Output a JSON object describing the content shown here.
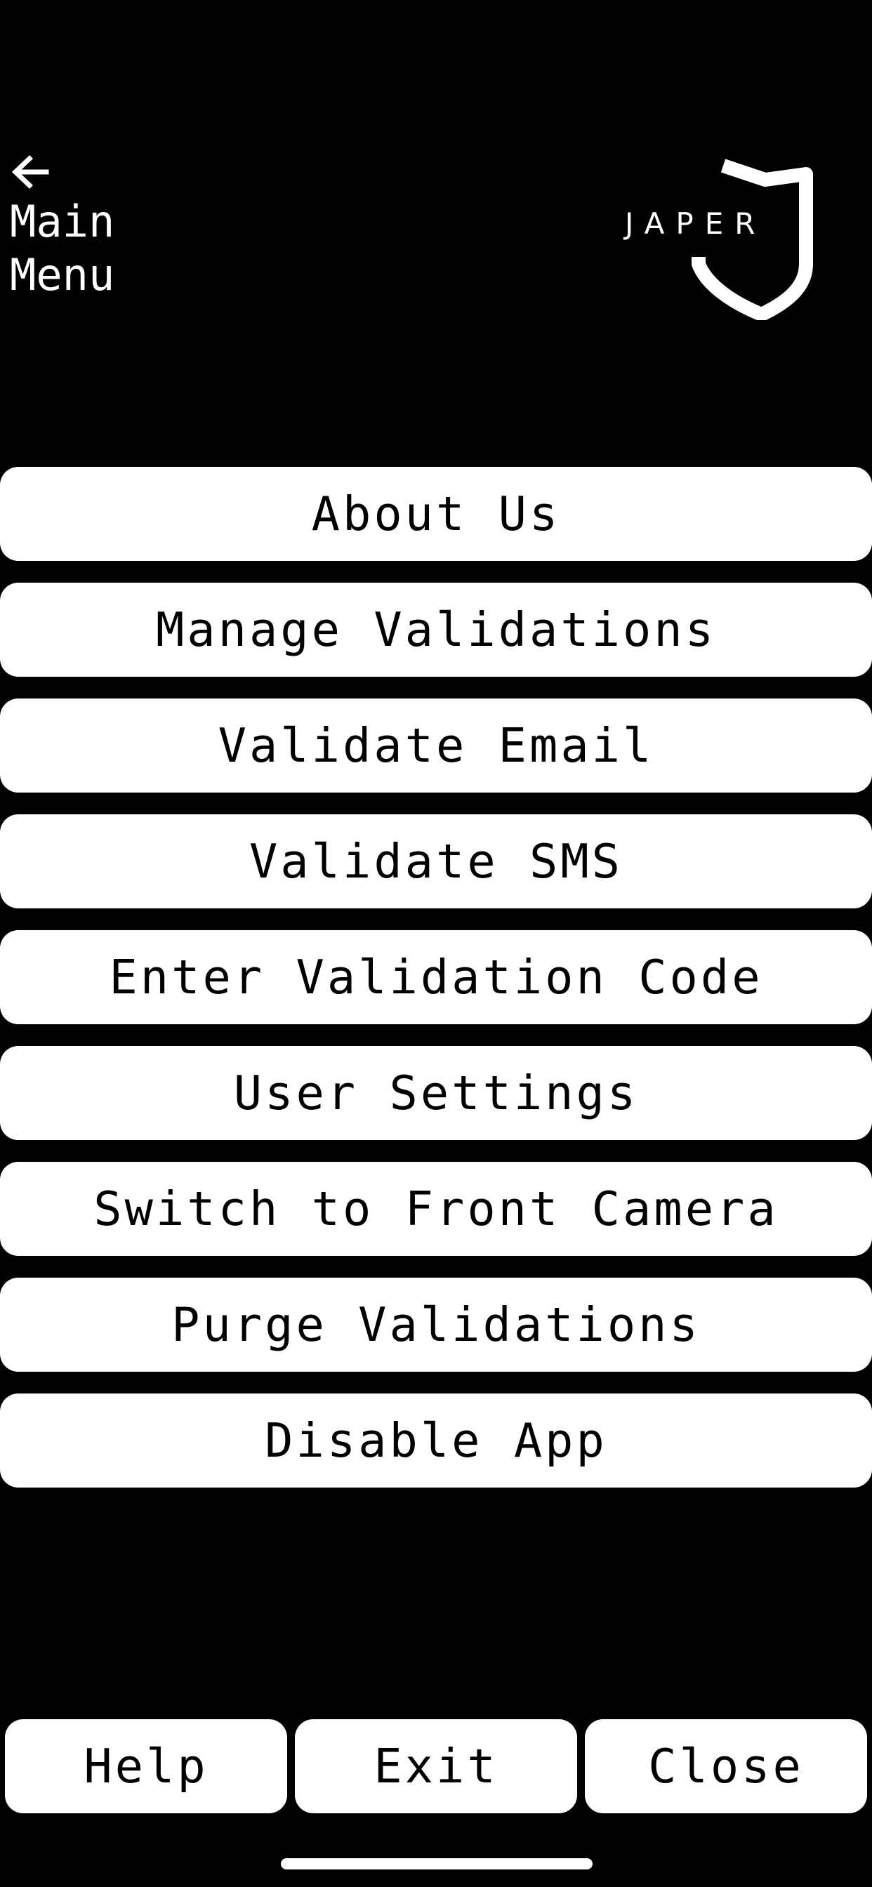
{
  "header": {
    "back_label": "Main Menu",
    "back_icon": "arrow-left-icon",
    "logo_text": "JAPER",
    "logo_icon": "shield-icon"
  },
  "menu": {
    "items": [
      {
        "label": "About Us"
      },
      {
        "label": "Manage Validations"
      },
      {
        "label": "Validate Email"
      },
      {
        "label": "Validate SMS"
      },
      {
        "label": "Enter Validation Code"
      },
      {
        "label": "User Settings"
      },
      {
        "label": "Switch to Front Camera"
      },
      {
        "label": "Purge Validations"
      },
      {
        "label": "Disable App"
      }
    ]
  },
  "footer": {
    "help_label": "Help",
    "exit_label": "Exit",
    "close_label": "Close"
  },
  "colors": {
    "background": "#000000",
    "button_bg": "#ffffff",
    "button_text": "#000000",
    "text": "#ffffff"
  }
}
